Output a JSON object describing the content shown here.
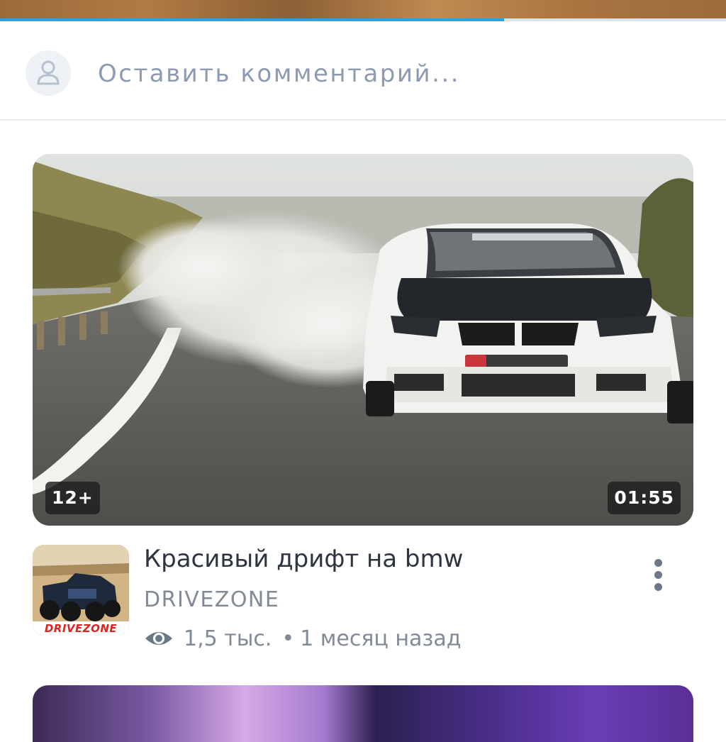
{
  "player": {
    "progress_fraction": 0.694
  },
  "comments": {
    "placeholder": "Оставить комментарий...",
    "avatar_icon": "person-icon"
  },
  "video": {
    "age_rating": "12+",
    "duration": "01:55",
    "title": "Красивый дрифт на bmw",
    "channel": "DRIVEZONE",
    "views": "1,5 тыс.",
    "separator": "•",
    "published": "1 месяц назад",
    "views_icon": "eye-icon",
    "more_icon": "more-vertical-icon",
    "thumbnail_alt": "white BMW drifting on mountain road with tire smoke",
    "channel_logo_text": "DRIVEZONE"
  },
  "colors": {
    "accent": "#2aa3e6",
    "title": "#2e3440",
    "secondary": "#818a96",
    "placeholder": "#8c9bb1"
  }
}
